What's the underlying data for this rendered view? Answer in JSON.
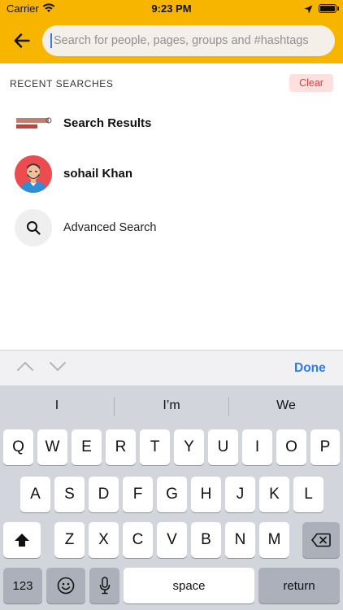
{
  "status_bar": {
    "carrier": "Carrier",
    "time": "9:23 PM"
  },
  "search": {
    "placeholder": "Search for people, pages, groups and #hashtags",
    "value": ""
  },
  "recent": {
    "header": "RECENT SEARCHES",
    "clear_label": "Clear",
    "items": [
      {
        "label": "Search Results",
        "icon": "search-results-thumbnail"
      },
      {
        "label": "sohail Khan",
        "icon": "user-avatar"
      },
      {
        "label": "Advanced Search",
        "icon": "search-icon"
      }
    ]
  },
  "keyboard_toolbar": {
    "done_label": "Done"
  },
  "keyboard": {
    "suggestions": [
      "I",
      "I’m",
      "We"
    ],
    "row1": [
      "Q",
      "W",
      "E",
      "R",
      "T",
      "Y",
      "U",
      "I",
      "O",
      "P"
    ],
    "row2": [
      "A",
      "S",
      "D",
      "F",
      "G",
      "H",
      "J",
      "K",
      "L"
    ],
    "row3": [
      "Z",
      "X",
      "C",
      "V",
      "B",
      "N",
      "M"
    ],
    "numbers_label": "123",
    "space_label": "space",
    "return_label": "return"
  },
  "colors": {
    "header": "#f8b500",
    "clear_bg": "#fde0de",
    "clear_text": "#e23c39",
    "done": "#2b7de9",
    "avatar_bg": "#ec4c4f"
  }
}
